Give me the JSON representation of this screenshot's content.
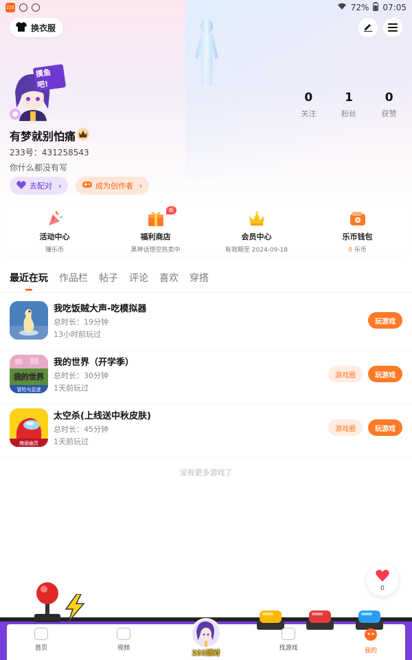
{
  "statusbar": {
    "app_badge": "233",
    "battery": "72%",
    "time": "07:05"
  },
  "header": {
    "outfit_label": "换衣服"
  },
  "profile": {
    "avatar_sticker": "摸鱼吧!",
    "stats": [
      {
        "value": "0",
        "label": "关注"
      },
      {
        "value": "1",
        "label": "粉丝"
      },
      {
        "value": "0",
        "label": "获赞"
      }
    ],
    "username": "有梦就别怕痛",
    "id_text": "233号：431258543",
    "bio": "你什么都没有写",
    "chip_match": "去配对",
    "chip_creator": "成为创作者"
  },
  "features": [
    {
      "title": "活动中心",
      "sub": "赚乐币",
      "icon": "party-popper-icon"
    },
    {
      "title": "福利商店",
      "sub": "黑神话悟空热卖中",
      "icon": "gift-shop-icon",
      "badge": "新"
    },
    {
      "title": "会员中心",
      "sub": "有效期至 2024-09-18",
      "icon": "crown-icon"
    },
    {
      "title": "乐币钱包",
      "sub_num": "0",
      "sub_unit": " 乐币",
      "icon": "wallet-icon"
    }
  ],
  "tabs": [
    "最近在玩",
    "作品栏",
    "帖子",
    "评论",
    "喜欢",
    "穿搭"
  ],
  "games": [
    {
      "title": "我吃饭贼大声-吃模拟器",
      "duration": "总时长：19分钟",
      "last": "13小时前玩过",
      "play": "玩游戏",
      "circle": ""
    },
    {
      "title": "我的世界（开学季）",
      "duration": "总时长：30分钟",
      "last": "1天前玩过",
      "play": "玩游戏",
      "circle": "游戏圈",
      "icon_caption": "冒险与足迹",
      "icon_logo": "我的世界"
    },
    {
      "title": "太空杀(上线送中秋皮肤)",
      "duration": "总时长：45分钟",
      "last": "1天前玩过",
      "play": "玩游戏",
      "circle": "游戏圈",
      "icon_caption": "掩面幽灵"
    }
  ],
  "no_more": "没有更多游戏了",
  "fav_count": "0",
  "nav": {
    "home": "首页",
    "video": "视频",
    "center": "233派对",
    "find": "找游戏",
    "mine": "我的"
  },
  "colors": {
    "accent": "#ff6a1f",
    "purple": "#7840d8"
  }
}
